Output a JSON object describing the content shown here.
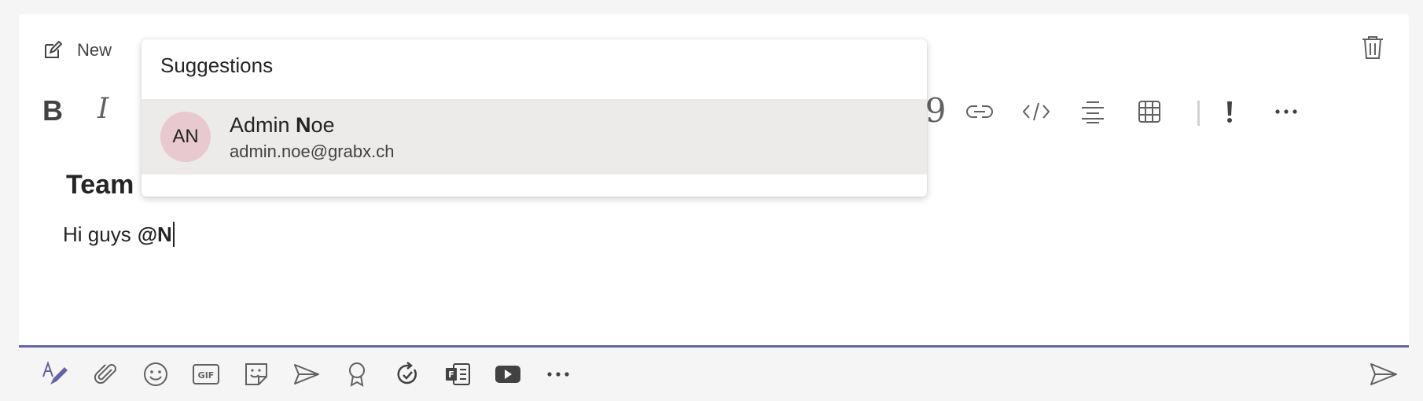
{
  "compose": {
    "new_label": "New",
    "heading": "Team",
    "body_text": "Hi guys",
    "mention_text": "@N"
  },
  "suggestions": {
    "title": "Suggestions",
    "items": [
      {
        "initials": "AN",
        "name_prefix": "Admin ",
        "name_match": "N",
        "name_suffix": "oe",
        "email": "admin.noe@grabx.ch"
      }
    ]
  },
  "toolbar": {
    "bold_glyph": "B",
    "italic_glyph": "I",
    "quote_glyph": "99",
    "more_glyph": "···"
  },
  "icons": {
    "top": [
      "edit-icon",
      "trash-icon"
    ],
    "format": [
      "bold-icon",
      "italic-icon",
      "quote-icon",
      "link-icon",
      "code-icon",
      "align-center-icon",
      "table-icon",
      "important-icon",
      "more-icon"
    ],
    "bottom": [
      "format-icon",
      "attach-icon",
      "emoji-icon",
      "gif-icon",
      "sticker-icon",
      "schedule-meeting-icon",
      "praise-icon",
      "loop-icon",
      "forms-icon",
      "video-icon",
      "more-icon",
      "send-icon"
    ]
  },
  "colors": {
    "accent": "#6264a7",
    "avatar_bg": "#e8c9cf",
    "highlight_bg": "#edebe9"
  }
}
